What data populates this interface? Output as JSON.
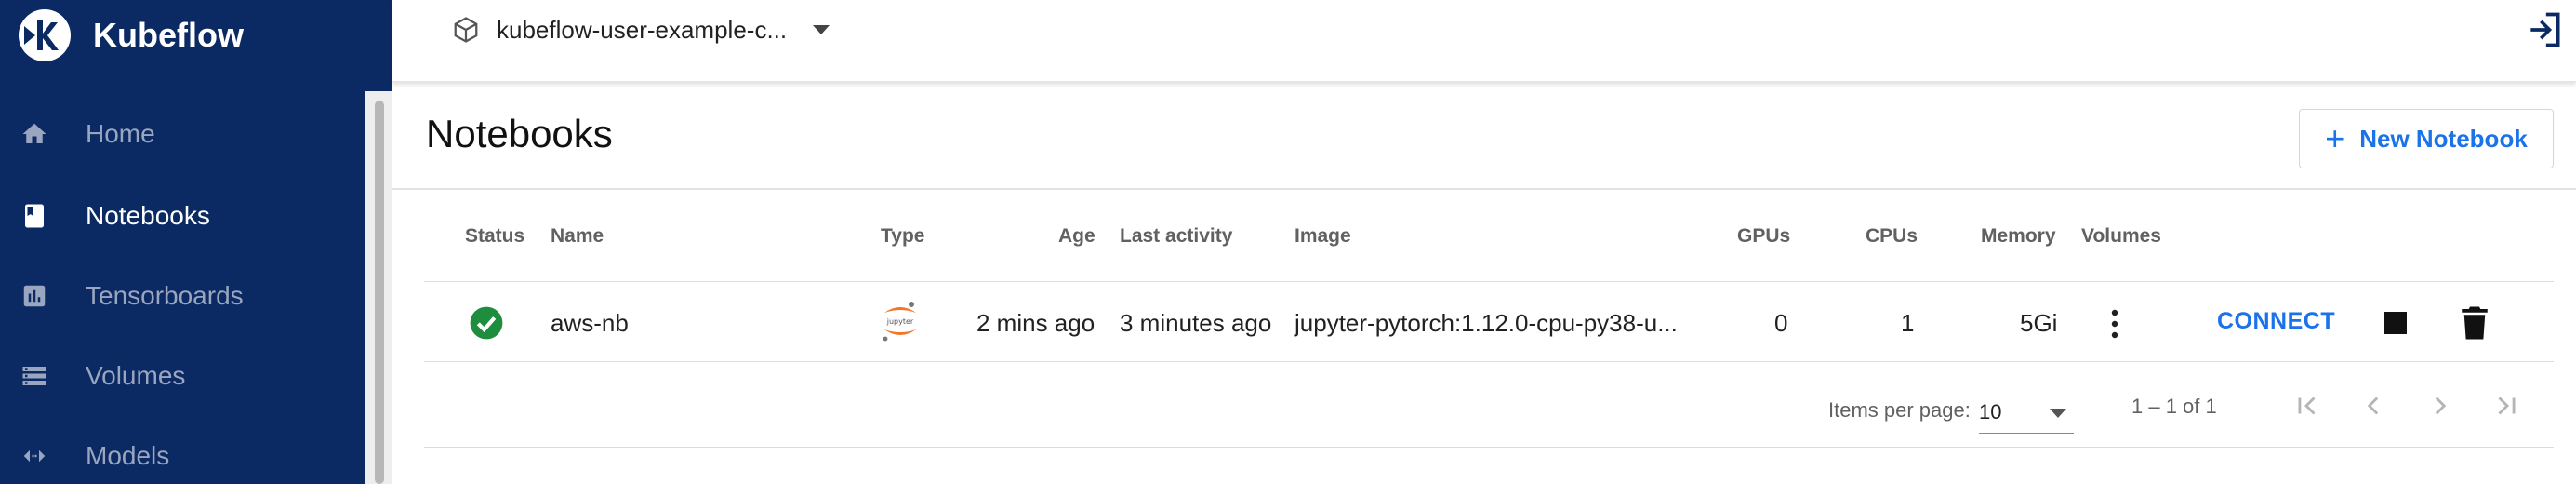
{
  "app": {
    "brand": "Kubeflow"
  },
  "sidebar": {
    "items": [
      {
        "label": "Home",
        "icon": "home-icon"
      },
      {
        "label": "Notebooks",
        "icon": "book-icon",
        "active": true
      },
      {
        "label": "Tensorboards",
        "icon": "chart-icon"
      },
      {
        "label": "Volumes",
        "icon": "storage-icon"
      },
      {
        "label": "Models",
        "icon": "code-arrows-icon"
      }
    ]
  },
  "topbar": {
    "namespace": "kubeflow-user-example-c...",
    "namespace_icon": "cube-icon",
    "logout_icon": "logout-icon"
  },
  "main": {
    "title": "Notebooks",
    "new_button": "New Notebook"
  },
  "table": {
    "columns": [
      "Status",
      "Name",
      "Type",
      "Age",
      "Last activity",
      "Image",
      "GPUs",
      "CPUs",
      "Memory",
      "Volumes"
    ],
    "rows": [
      {
        "status": "running",
        "name": "aws-nb",
        "type": "jupyter",
        "age": "2 mins ago",
        "last_activity": "3 minutes ago",
        "image": "jupyter-pytorch:1.12.0-cpu-py38-u...",
        "gpus": "0",
        "cpus": "1",
        "memory": "5Gi",
        "connect": "CONNECT"
      }
    ]
  },
  "paginator": {
    "items_per_page_label": "Items per page:",
    "page_size": "10",
    "range": "1 – 1 of 1"
  },
  "colors": {
    "sidebar_bg": "#0b2a63",
    "accent": "#1a73e8",
    "status_ok": "#1e8e3e",
    "jupyter_orange": "#f37626"
  }
}
